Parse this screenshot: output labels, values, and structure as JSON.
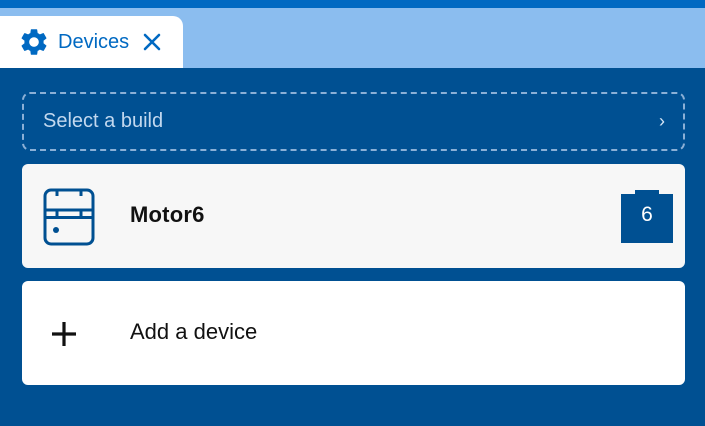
{
  "tab": {
    "label": "Devices",
    "icon": "gear-icon",
    "close_icon": "close-icon"
  },
  "build_select": {
    "placeholder": "Select a build",
    "chevron": "›"
  },
  "devices": [
    {
      "name": "Motor6",
      "icon": "hub-icon",
      "port": "6"
    }
  ],
  "add_device": {
    "label": "Add a device",
    "icon": "plus-icon"
  },
  "colors": {
    "background": "#005092",
    "accent": "#0069c2",
    "tab_bar": "#8bbdef"
  }
}
